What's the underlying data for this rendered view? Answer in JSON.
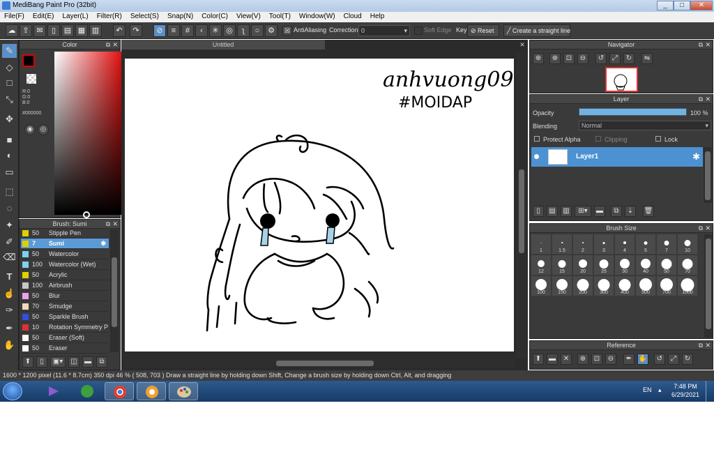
{
  "window": {
    "title": "MediBang Paint Pro (32bit)",
    "min": "_",
    "max": "□",
    "close": "✕"
  },
  "menu": [
    "File(F)",
    "Edit(E)",
    "Layer(L)",
    "Filter(R)",
    "Select(S)",
    "Snap(N)",
    "Color(C)",
    "View(V)",
    "Tool(T)",
    "Window(W)",
    "Cloud",
    "Help"
  ],
  "toolbar": {
    "antialiasing": "AntiAliasing",
    "correction_label": "Correction",
    "correction_value": "0",
    "soft_edge": "Soft Edge",
    "key": "Key",
    "reset": "Reset",
    "straight_line": "Create a straight line"
  },
  "color_panel": {
    "title": "Color",
    "r": "R:0",
    "g": "G:0",
    "b": "B:0",
    "hex": "#000000",
    "fg": "#000000"
  },
  "brush_panel": {
    "title": "Brush: Sumi",
    "items": [
      {
        "size": "50",
        "name": "Stipple Pen",
        "color": "#e0d000"
      },
      {
        "size": "7",
        "name": "Sumi",
        "color": "#e0d000"
      },
      {
        "size": "50",
        "name": "Watercolor",
        "color": "#7fd0f0"
      },
      {
        "size": "100",
        "name": "Watercolor (Wet)",
        "color": "#7fd0f0"
      },
      {
        "size": "50",
        "name": "Acrylic",
        "color": "#e0d000"
      },
      {
        "size": "100",
        "name": "Airbrush",
        "color": "#c8c8c8"
      },
      {
        "size": "50",
        "name": "Blur",
        "color": "#f0a0f0"
      },
      {
        "size": "70",
        "name": "Smudge",
        "color": "#f0d8c0"
      },
      {
        "size": "50",
        "name": "Sparkle Brush",
        "color": "#3050e0"
      },
      {
        "size": "10",
        "name": "Rotation Symmetry P",
        "color": "#e03030"
      },
      {
        "size": "50",
        "name": "Eraser (Soft)",
        "color": "#ffffff"
      },
      {
        "size": "50",
        "name": "Eraser",
        "color": "#ffffff"
      }
    ]
  },
  "canvas": {
    "tab_title": "Untitled",
    "handwriting_line1": "anhvuong098",
    "handwriting_line2": "#MOIDAP"
  },
  "navigator": {
    "title": "Navigator"
  },
  "layer_panel": {
    "title": "Layer",
    "opacity_label": "Opacity",
    "opacity_value": "100 %",
    "opacity_fraction": 1.0,
    "blending_label": "Blending",
    "blending_value": "Normal",
    "protect_alpha": "Protect Alpha",
    "clipping": "Clipping",
    "lock": "Lock",
    "layer_name": "Layer1"
  },
  "brush_size": {
    "title": "Brush Size",
    "sizes": [
      "1",
      "1.5",
      "2",
      "3",
      "4",
      "5",
      "7",
      "10",
      "12",
      "15",
      "20",
      "25",
      "30",
      "40",
      "50",
      "70",
      "100",
      "150",
      "200",
      "300",
      "400",
      "500",
      "700",
      "1000"
    ]
  },
  "reference": {
    "title": "Reference"
  },
  "status": {
    "text": "1600 * 1200 pixel   (11.6 * 8.7cm)   350 dpi   46 %   ( 508, 703 )   Draw a straight line by holding down Shift, Change a brush size by holding down Ctrl, Alt, and dragging"
  },
  "taskbar": {
    "lang": "EN",
    "time": "7:48 PM",
    "date": "6/29/2021"
  }
}
